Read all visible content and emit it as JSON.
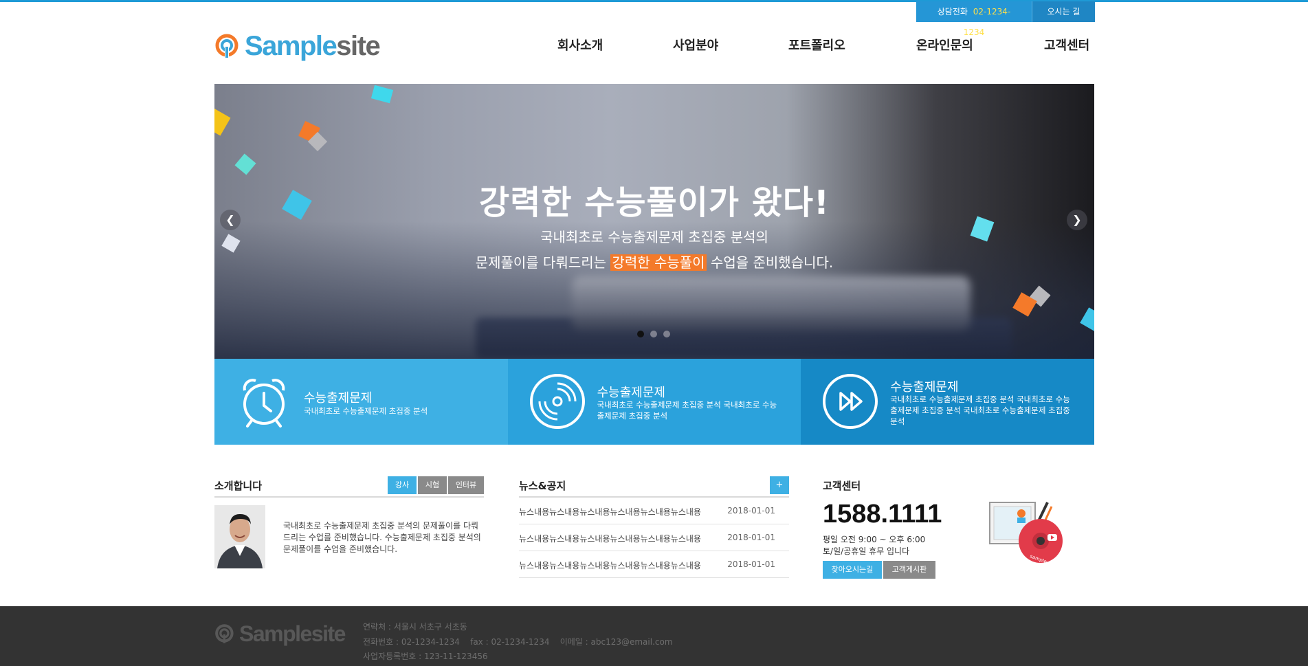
{
  "top_bar": {
    "call_label": "상담전화",
    "call_number": "02-1234-1234",
    "directions_label": "오시는 길"
  },
  "logo": {
    "part1": "Sample",
    "part2": "site"
  },
  "nav": [
    "회사소개",
    "사업분야",
    "포트폴리오",
    "온라인문의",
    "고객센터"
  ],
  "hero": {
    "title": "강력한 수능풀이가 왔다!",
    "sub1": "국내최초로 수능출제문제 초집중 분석의",
    "sub2_pre": "문제풀이를 다뤄드리는 ",
    "sub2_highlight": "강력한 수능풀이",
    "sub2_post": " 수업을 준비했습니다.",
    "prev_icon": "chevron-left-icon",
    "next_icon": "chevron-right-icon",
    "slides_active": 1,
    "slides_total": 3
  },
  "features": [
    {
      "icon": "alarm-clock-icon",
      "title": "수능출제문제",
      "desc": "국내최초로 수능출제문제 초집중 분석"
    },
    {
      "icon": "disc-icon",
      "title": "수능출제문제",
      "desc": "국내최초로 수능출제문제 초집중 분석 국내최초로 수능출제문제 초집중 분석"
    },
    {
      "icon": "fast-forward-icon",
      "title": "수능출제문제",
      "desc": "국내최초로 수능출제문제 초집중 분석 국내최초로 수능출제문제 초집중 분석 국내최초로 수능출제문제 초집중 분석"
    }
  ],
  "intro": {
    "title": "소개합니다",
    "tabs": [
      "강사",
      "시험",
      "인터뷰"
    ],
    "text": "국내최초로 수능출제문제 초집중 분석의 문제풀이를 다뤄드리는 수업를 준비했습니다. 수능출제문제 초집중 분석의 문제풀이를 수업을 준비했습니다."
  },
  "news": {
    "title": "뉴스&공지",
    "more_label": "+",
    "items": [
      {
        "text": "뉴스내용뉴스내용뉴스내용뉴스내용뉴스내용뉴스내용",
        "date": "2018-01-01"
      },
      {
        "text": "뉴스내용뉴스내용뉴스내용뉴스내용뉴스내용뉴스내용",
        "date": "2018-01-01"
      },
      {
        "text": "뉴스내용뉴스내용뉴스내용뉴스내용뉴스내용뉴스내용",
        "date": "2018-01-01"
      }
    ]
  },
  "cs": {
    "title": "고객센터",
    "phone": "1588.1111",
    "hours1": "평일 오전 9:00 ~ 오후 6:00",
    "hours2": "토/일/공휴일 휴무 입니다",
    "btn_directions": "찾아오시는길",
    "btn_board": "고객게시판",
    "art_text": "sample movie"
  },
  "footer": {
    "logo_part1": "Sample",
    "logo_part2": "site",
    "address": "연락처 : 서울시 서초구 서초동",
    "contact": "전화번호 : 02-1234-1234    fax : 02-1234-1234    이메일 : abc123@email.com",
    "biz": "사업자등록번호 : 123-11-123456"
  },
  "colors": {
    "accent": "#1e9ad6",
    "highlight": "#f47a2a",
    "feature1": "#3eb0e4",
    "feature2": "#2ba2dc",
    "feature3": "#1689c6",
    "footer": "#333333"
  }
}
